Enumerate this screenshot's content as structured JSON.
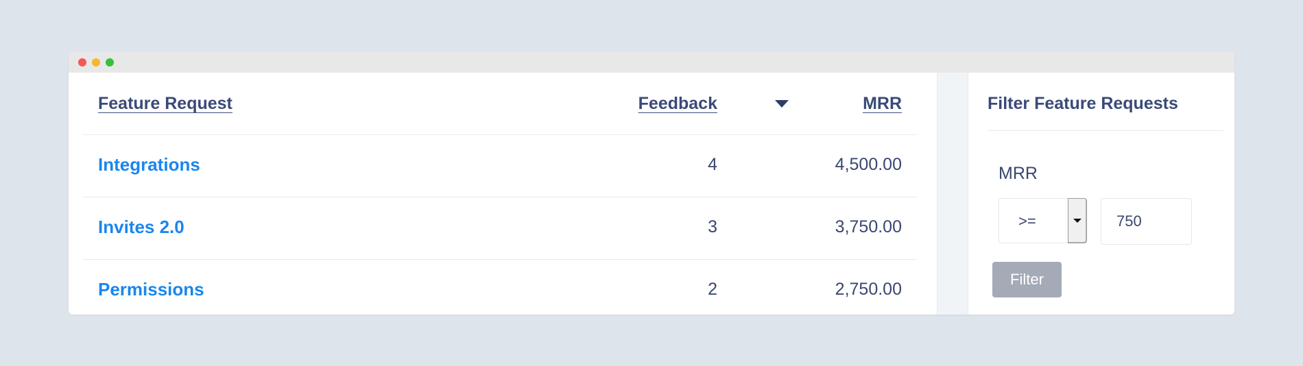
{
  "window": {
    "controls": [
      "close",
      "minimize",
      "maximize"
    ]
  },
  "table": {
    "columns": {
      "feature": "Feature Request",
      "feedback": "Feedback",
      "mrr": "MRR"
    },
    "sort": {
      "column": "feedback",
      "direction": "descending",
      "icon": "caret-down-icon"
    },
    "rows": [
      {
        "name": "Integrations",
        "feedback": "4",
        "mrr": "4,500.00"
      },
      {
        "name": "Invites 2.0",
        "feedback": "3",
        "mrr": "3,750.00"
      },
      {
        "name": "Permissions",
        "feedback": "2",
        "mrr": "2,750.00"
      }
    ]
  },
  "filter": {
    "title": "Filter Feature Requests",
    "field_label": "MRR",
    "operator": ">=",
    "value": "750",
    "button_label": "Filter"
  },
  "colors": {
    "background": "#dde4ec",
    "link": "#1a86ee",
    "heading": "#3a4a78",
    "text": "#3a4670",
    "filter_button": "#a5aab7",
    "titlebar": "#e8e8e8"
  }
}
